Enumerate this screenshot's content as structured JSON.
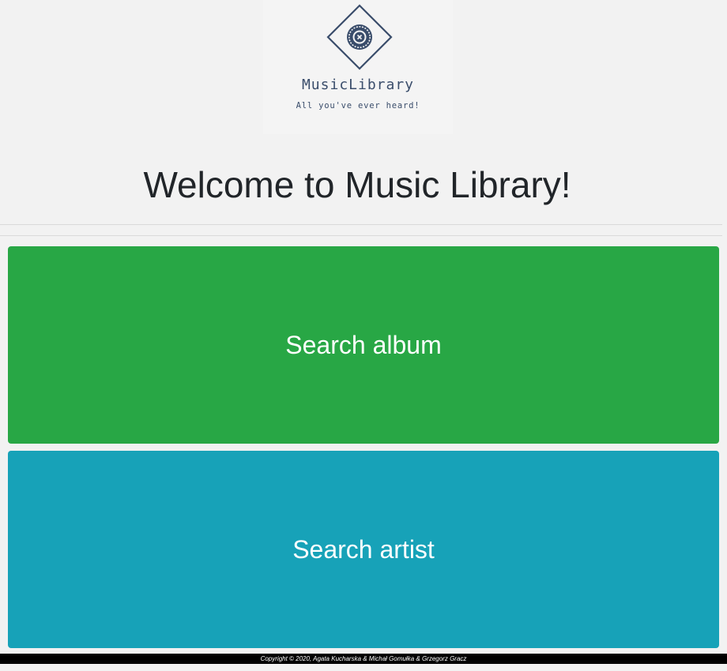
{
  "header": {
    "logo_name": "MusicLibrary",
    "logo_tagline": "All you've ever heard!",
    "logo_color": "#3a4d6b"
  },
  "main": {
    "title": "Welcome to Music Library!",
    "buttons": [
      {
        "label": "Search album",
        "color": "#28a745"
      },
      {
        "label": "Search artist",
        "color": "#17a2b8"
      }
    ]
  },
  "footer": {
    "copyright": "Copyright © 2020, Agata Kucharska & Michał Gomułka & Grzegorz Gracz"
  }
}
